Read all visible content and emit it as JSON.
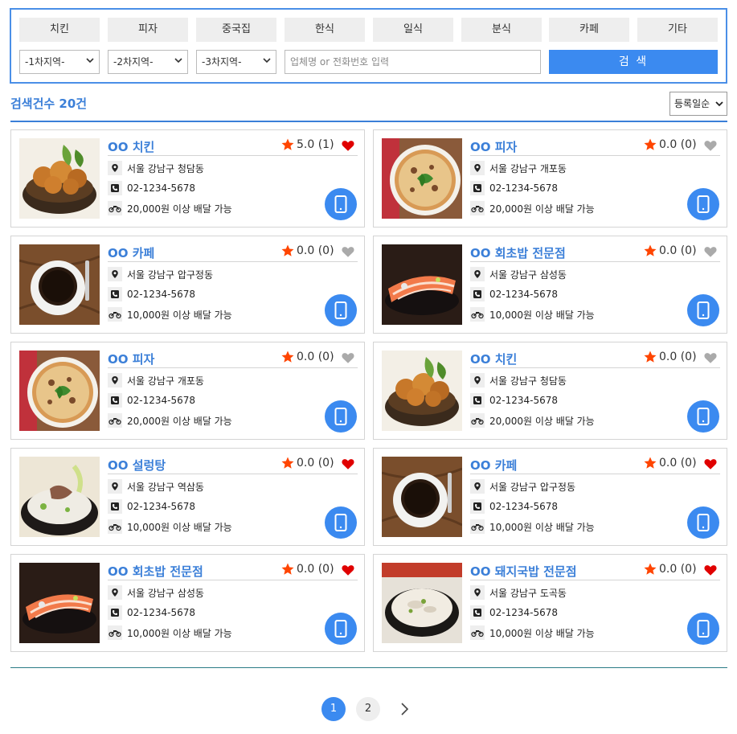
{
  "categories": [
    "치킨",
    "피자",
    "중국집",
    "한식",
    "일식",
    "분식",
    "카페",
    "기타"
  ],
  "regions": [
    "-1차지역-",
    "-2차지역-",
    "-3차지역-"
  ],
  "search": {
    "placeholder": "업체명 or 전화번호 입력",
    "button_label": "검 색"
  },
  "result_count": "검색건수 20건",
  "sort": {
    "selected": "등록일순"
  },
  "colors": {
    "accent": "#3b8af0",
    "title": "#3b7fd8",
    "star": "#ff4500",
    "heart_on": "#e00000",
    "heart_off": "#aaaaaa"
  },
  "listings": [
    {
      "name": "OO 치킨",
      "rating": "5.0 (1)",
      "favorited": true,
      "address": "서울 강남구 청담동",
      "phone": "02-1234-5678",
      "delivery": "20,000원 이상 배달 가능",
      "photo": "chicken-photo"
    },
    {
      "name": "OO 피자",
      "rating": "0.0 (0)",
      "favorited": false,
      "address": "서울 강남구 개포동",
      "phone": "02-1234-5678",
      "delivery": "20,000원 이상 배달 가능",
      "photo": "pizza-photo"
    },
    {
      "name": "OO 카페",
      "rating": "0.0 (0)",
      "favorited": false,
      "address": "서울 강남구 압구정동",
      "phone": "02-1234-5678",
      "delivery": "10,000원 이상 배달 가능",
      "photo": "coffee-photo"
    },
    {
      "name": "OO 회초밥 전문점",
      "rating": "0.0 (0)",
      "favorited": false,
      "address": "서울 강남구 삼성동",
      "phone": "02-1234-5678",
      "delivery": "10,000원 이상 배달 가능",
      "photo": "sashimi-photo"
    },
    {
      "name": "OO 피자",
      "rating": "0.0 (0)",
      "favorited": false,
      "address": "서울 강남구 개포동",
      "phone": "02-1234-5678",
      "delivery": "20,000원 이상 배달 가능",
      "photo": "pizza-photo"
    },
    {
      "name": "OO 치킨",
      "rating": "0.0 (0)",
      "favorited": false,
      "address": "서울 강남구 청담동",
      "phone": "02-1234-5678",
      "delivery": "20,000원 이상 배달 가능",
      "photo": "chicken-photo"
    },
    {
      "name": "OO 설렁탕",
      "rating": "0.0 (0)",
      "favorited": true,
      "address": "서울 강남구 역삼동",
      "phone": "02-1234-5678",
      "delivery": "10,000원 이상 배달 가능",
      "photo": "soup-photo"
    },
    {
      "name": "OO 카페",
      "rating": "0.0 (0)",
      "favorited": true,
      "address": "서울 강남구 압구정동",
      "phone": "02-1234-5678",
      "delivery": "10,000원 이상 배달 가능",
      "photo": "coffee-photo"
    },
    {
      "name": "OO 회초밥 전문점",
      "rating": "0.0 (0)",
      "favorited": true,
      "address": "서울 강남구 삼성동",
      "phone": "02-1234-5678",
      "delivery": "10,000원 이상 배달 가능",
      "photo": "sashimi-photo"
    },
    {
      "name": "OO 돼지국밥 전문점",
      "rating": "0.0 (0)",
      "favorited": true,
      "address": "서울 강남구 도곡동",
      "phone": "02-1234-5678",
      "delivery": "10,000원 이상 배달 가능",
      "photo": "gukbap-photo"
    }
  ],
  "pagination": {
    "pages": [
      "1",
      "2"
    ],
    "current": "1"
  }
}
